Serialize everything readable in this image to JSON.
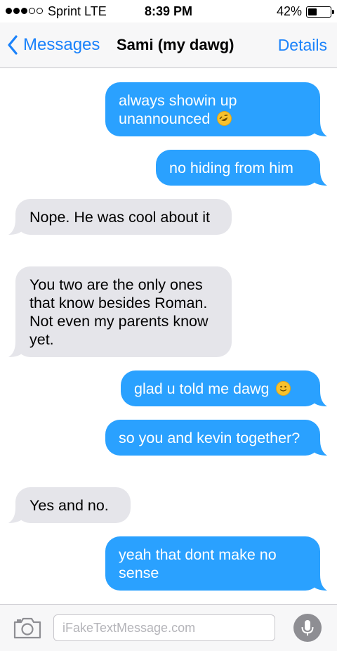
{
  "status_bar": {
    "signal_dots_filled": 3,
    "signal_dots_total": 5,
    "carrier": "Sprint  LTE",
    "time": "8:39 PM",
    "battery_percent": "42%",
    "battery_level": 0.42
  },
  "nav": {
    "back_label": "Messages",
    "title": "Sami (my dawg)",
    "details_label": "Details"
  },
  "messages": [
    {
      "side": "sent",
      "text": "always showin up unannounced",
      "emoji": "rofl-emoji"
    },
    {
      "side": "sent",
      "text": "no hiding from him"
    },
    {
      "side": "received",
      "text": "Nope. He was cool about it"
    },
    {
      "side": "received",
      "text": "You two are the only ones that know besides Roman. Not even my parents know yet."
    },
    {
      "side": "sent",
      "text": "glad u told me dawg",
      "emoji": "slight-smile-emoji"
    },
    {
      "side": "sent",
      "text": "so you and kevin together?"
    },
    {
      "side": "received",
      "text": "Yes and no."
    },
    {
      "side": "sent",
      "text": "yeah that dont make no sense"
    }
  ],
  "input_bar": {
    "placeholder": "iFakeTextMessage.com",
    "camera_icon": "camera-icon",
    "mic_icon": "microphone-icon"
  },
  "colors": {
    "accent": "#1a82fb",
    "sent_bubble": "#2aa1ff",
    "received_bubble": "#e5e5ea",
    "bar_background": "#f7f7f8"
  }
}
